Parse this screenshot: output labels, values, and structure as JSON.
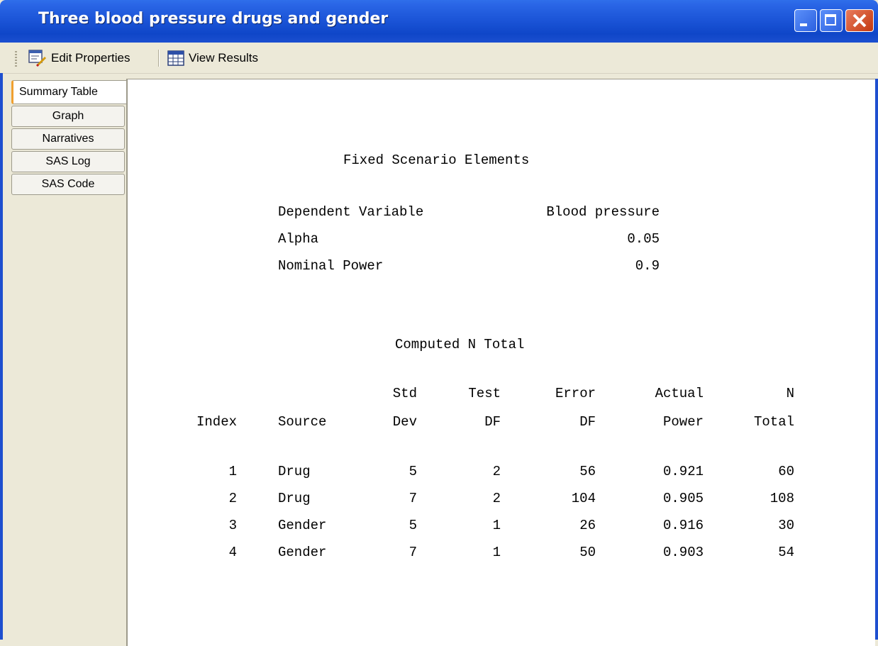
{
  "window": {
    "title": "Three blood pressure drugs and gender",
    "controls": [
      "minimize",
      "maximize",
      "close"
    ]
  },
  "toolbar": {
    "edit_label": "Edit Properties",
    "view_label": "View Results",
    "edit_icon": "edit-properties-icon",
    "view_icon": "view-results-icon"
  },
  "tabs": [
    {
      "label": "Summary Table",
      "active": true
    },
    {
      "label": "Graph",
      "active": false
    },
    {
      "label": "Narratives",
      "active": false
    },
    {
      "label": "SAS Log",
      "active": false
    },
    {
      "label": "SAS Code",
      "active": false
    }
  ],
  "fixed": {
    "heading": "Fixed Scenario Elements",
    "rows": [
      {
        "label": "Dependent Variable",
        "value": "Blood pressure"
      },
      {
        "label": "Alpha",
        "value": "0.05"
      },
      {
        "label": "Nominal Power",
        "value": "0.9"
      }
    ]
  },
  "computed": {
    "heading": "Computed N Total",
    "header_top": [
      "",
      "",
      "Std",
      "Test",
      "Error",
      "Actual",
      "N"
    ],
    "header_bottom": [
      "Index",
      "Source",
      "Dev",
      "DF",
      "DF",
      "Power",
      "Total"
    ],
    "rows": [
      [
        "1",
        "Drug",
        "5",
        "2",
        "56",
        "0.921",
        "60"
      ],
      [
        "2",
        "Drug",
        "7",
        "2",
        "104",
        "0.905",
        "108"
      ],
      [
        "3",
        "Gender",
        "5",
        "1",
        "26",
        "0.916",
        "30"
      ],
      [
        "4",
        "Gender",
        "7",
        "1",
        "50",
        "0.903",
        "54"
      ]
    ]
  },
  "colors": {
    "titlebar": "#0f46c8",
    "active_tab_accent": "#f0a030",
    "chrome": "#ece9d8"
  }
}
